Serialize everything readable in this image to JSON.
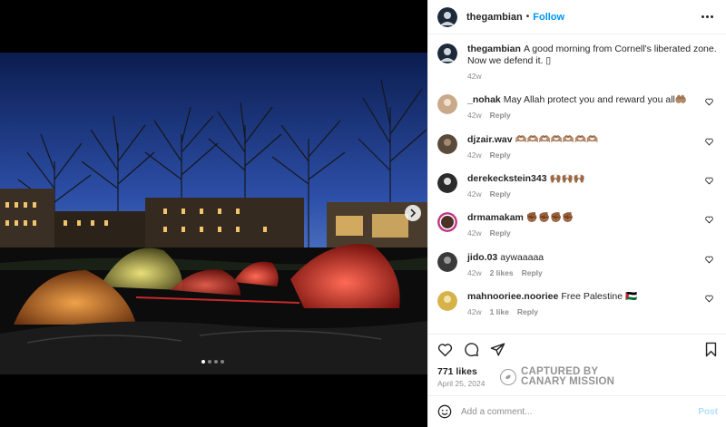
{
  "post": {
    "username": "thegambian",
    "follow_label": "Follow",
    "separator": "•",
    "caption": "A good morning from Cornell's liberated zone. Now we defend it. ▯",
    "caption_age": "42w",
    "likes": "771 likes",
    "date": "April 25, 2024",
    "carousel_dots": 4,
    "carousel_active": 0
  },
  "comments": [
    {
      "user": "_nohak",
      "text": "May Allah protect you and reward you all🤲🏽",
      "age": "42w",
      "likes": "",
      "reply": "Reply",
      "avatar_color": "#c8a98a"
    },
    {
      "user": "djzair.wav",
      "text": "🫶🏽🫶🏽🫶🏽🫶🏽🫶🏽🫶🏽🫶🏽",
      "age": "42w",
      "likes": "",
      "reply": "Reply",
      "avatar_color": "#5a4a3a"
    },
    {
      "user": "derekeckstein343",
      "text": "🙌🏾🙌🏾🙌🏾",
      "age": "42w",
      "likes": "",
      "reply": "Reply",
      "avatar_color": "#2b2b2b"
    },
    {
      "user": "drmamakam",
      "text": "✊🏾✊🏾✊🏾✊🏾",
      "age": "42w",
      "likes": "",
      "reply": "Reply",
      "avatar_color": "#c13584"
    },
    {
      "user": "jido.03",
      "text": "aywaaaaa",
      "age": "42w",
      "likes": "2 likes",
      "reply": "Reply",
      "avatar_color": "#3a3a3a"
    },
    {
      "user": "mahnooriee.nooriee",
      "text": "Free Palestine 🇵🇸",
      "age": "42w",
      "likes": "1 like",
      "reply": "Reply",
      "avatar_color": "#d6b24a"
    }
  ],
  "compose": {
    "placeholder": "Add a comment...",
    "post_label": "Post"
  },
  "watermark": {
    "line1": "CAPTURED BY",
    "line2": "CANARY MISSION"
  },
  "icons": {
    "more": "more-options-icon",
    "like": "heart-icon",
    "comment": "comment-icon",
    "share": "send-icon",
    "save": "bookmark-icon",
    "emoji": "emoji-icon",
    "next": "chevron-right-icon"
  }
}
